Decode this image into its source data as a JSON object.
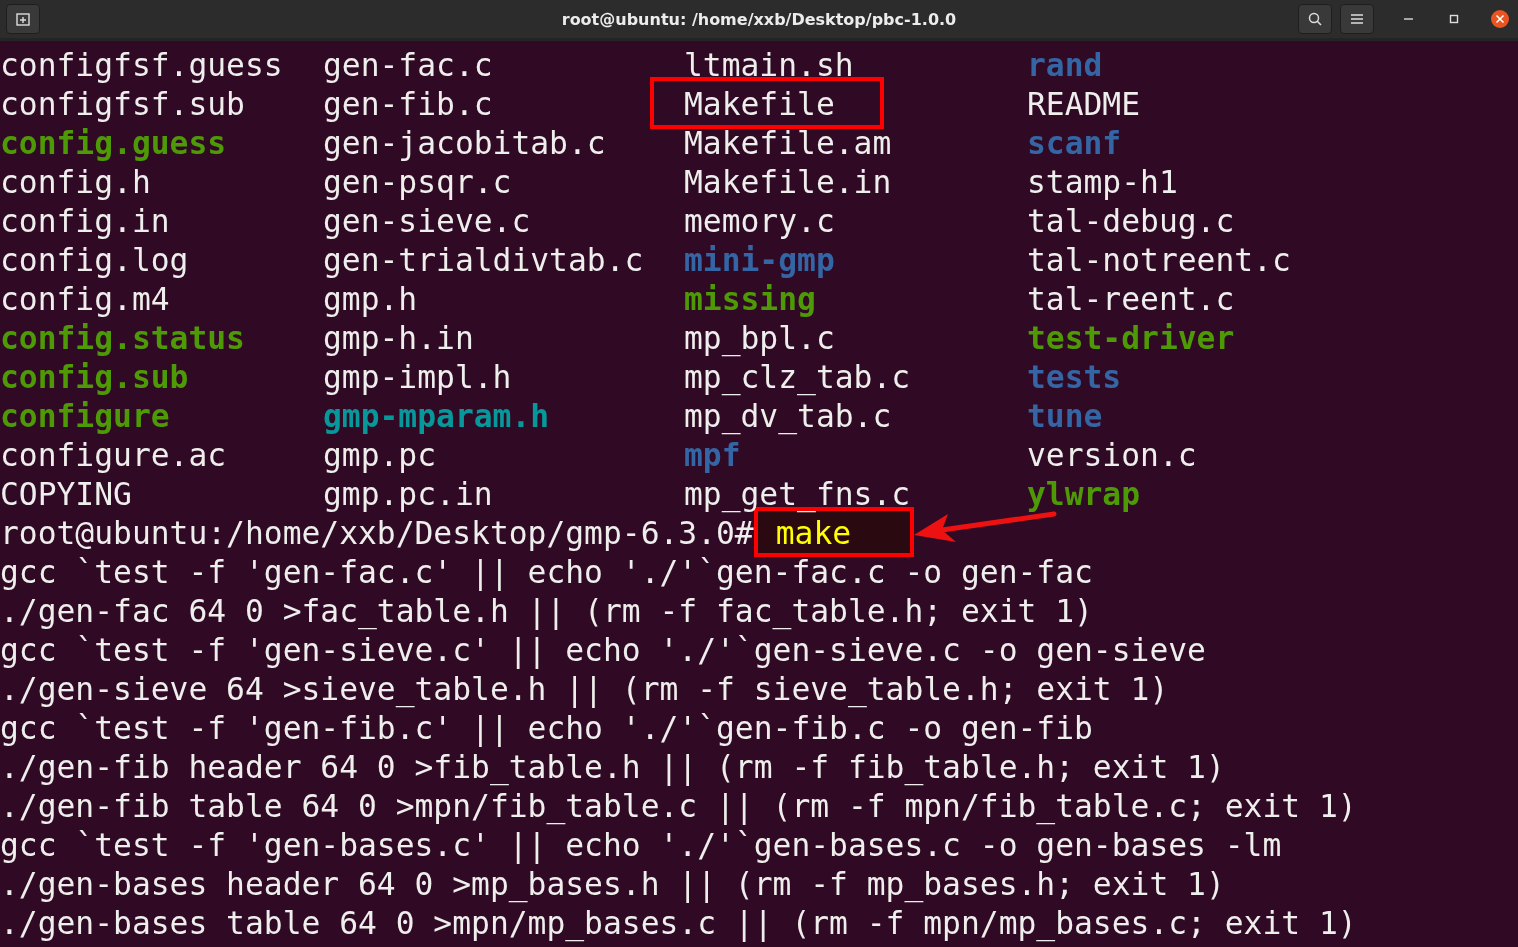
{
  "window": {
    "title": "root@ubuntu: /home/xxb/Desktop/pbc-1.0.0"
  },
  "listing": [
    [
      {
        "name": "configfsf.guess",
        "kind": "file",
        "boxed": false
      },
      {
        "name": "gen-fac.c",
        "kind": "file",
        "boxed": false
      },
      {
        "name": "ltmain.sh",
        "kind": "file",
        "boxed": false
      },
      {
        "name": "rand",
        "kind": "dir",
        "boxed": false
      }
    ],
    [
      {
        "name": "configfsf.sub",
        "kind": "file",
        "boxed": false
      },
      {
        "name": "gen-fib.c",
        "kind": "file",
        "boxed": false
      },
      {
        "name": "Makefile",
        "kind": "file",
        "boxed": true
      },
      {
        "name": "README",
        "kind": "file",
        "boxed": false
      }
    ],
    [
      {
        "name": "config.guess",
        "kind": "exec",
        "boxed": false
      },
      {
        "name": "gen-jacobitab.c",
        "kind": "file",
        "boxed": false
      },
      {
        "name": "Makefile.am",
        "kind": "file",
        "boxed": false
      },
      {
        "name": "scanf",
        "kind": "dir",
        "boxed": false
      }
    ],
    [
      {
        "name": "config.h",
        "kind": "file",
        "boxed": false
      },
      {
        "name": "gen-psqr.c",
        "kind": "file",
        "boxed": false
      },
      {
        "name": "Makefile.in",
        "kind": "file",
        "boxed": false
      },
      {
        "name": "stamp-h1",
        "kind": "file",
        "boxed": false
      }
    ],
    [
      {
        "name": "config.in",
        "kind": "file",
        "boxed": false
      },
      {
        "name": "gen-sieve.c",
        "kind": "file",
        "boxed": false
      },
      {
        "name": "memory.c",
        "kind": "file",
        "boxed": false
      },
      {
        "name": "tal-debug.c",
        "kind": "file",
        "boxed": false
      }
    ],
    [
      {
        "name": "config.log",
        "kind": "file",
        "boxed": false
      },
      {
        "name": "gen-trialdivtab.c",
        "kind": "file",
        "boxed": false
      },
      {
        "name": "mini-gmp",
        "kind": "dir",
        "boxed": false
      },
      {
        "name": "tal-notreent.c",
        "kind": "file",
        "boxed": false
      }
    ],
    [
      {
        "name": "config.m4",
        "kind": "file",
        "boxed": false
      },
      {
        "name": "gmp.h",
        "kind": "file",
        "boxed": false
      },
      {
        "name": "missing",
        "kind": "exec",
        "boxed": false
      },
      {
        "name": "tal-reent.c",
        "kind": "file",
        "boxed": false
      }
    ],
    [
      {
        "name": "config.status",
        "kind": "exec",
        "boxed": false
      },
      {
        "name": "gmp-h.in",
        "kind": "file",
        "boxed": false
      },
      {
        "name": "mp_bpl.c",
        "kind": "file",
        "boxed": false
      },
      {
        "name": "test-driver",
        "kind": "exec",
        "boxed": false
      }
    ],
    [
      {
        "name": "config.sub",
        "kind": "exec",
        "boxed": false
      },
      {
        "name": "gmp-impl.h",
        "kind": "file",
        "boxed": false
      },
      {
        "name": "mp_clz_tab.c",
        "kind": "file",
        "boxed": false
      },
      {
        "name": "tests",
        "kind": "dir",
        "boxed": false
      }
    ],
    [
      {
        "name": "configure",
        "kind": "exec",
        "boxed": false
      },
      {
        "name": "gmp-mparam.h",
        "kind": "link",
        "boxed": false
      },
      {
        "name": "mp_dv_tab.c",
        "kind": "file",
        "boxed": false
      },
      {
        "name": "tune",
        "kind": "dir",
        "boxed": false
      }
    ],
    [
      {
        "name": "configure.ac",
        "kind": "file",
        "boxed": false
      },
      {
        "name": "gmp.pc",
        "kind": "file",
        "boxed": false
      },
      {
        "name": "mpf",
        "kind": "dir",
        "boxed": false
      },
      {
        "name": "version.c",
        "kind": "file",
        "boxed": false
      }
    ],
    [
      {
        "name": "COPYING",
        "kind": "file",
        "boxed": false
      },
      {
        "name": "gmp.pc.in",
        "kind": "file",
        "boxed": false
      },
      {
        "name": "mp_get_fns.c",
        "kind": "file",
        "boxed": false
      },
      {
        "name": "ylwrap",
        "kind": "exec",
        "boxed": false
      }
    ]
  ],
  "prompt": {
    "text": "root@ubuntu:/home/xxb/Desktop/gmp-6.3.0#",
    "command": "make",
    "boxed": true
  },
  "output": [
    "gcc `test -f 'gen-fac.c' || echo './'`gen-fac.c -o gen-fac",
    "./gen-fac 64 0 >fac_table.h || (rm -f fac_table.h; exit 1)",
    "gcc `test -f 'gen-sieve.c' || echo './'`gen-sieve.c -o gen-sieve",
    "./gen-sieve 64 >sieve_table.h || (rm -f sieve_table.h; exit 1)",
    "gcc `test -f 'gen-fib.c' || echo './'`gen-fib.c -o gen-fib",
    "./gen-fib header 64 0 >fib_table.h || (rm -f fib_table.h; exit 1)",
    "./gen-fib table 64 0 >mpn/fib_table.c || (rm -f mpn/fib_table.c; exit 1)",
    "gcc `test -f 'gen-bases.c' || echo './'`gen-bases.c -o gen-bases -lm",
    "./gen-bases header 64 0 >mp_bases.h || (rm -f mp_bases.h; exit 1)",
    "./gen-bases table 64 0 >mpn/mp_bases.c || (rm -f mpn/mp_bases.c; exit 1)"
  ]
}
